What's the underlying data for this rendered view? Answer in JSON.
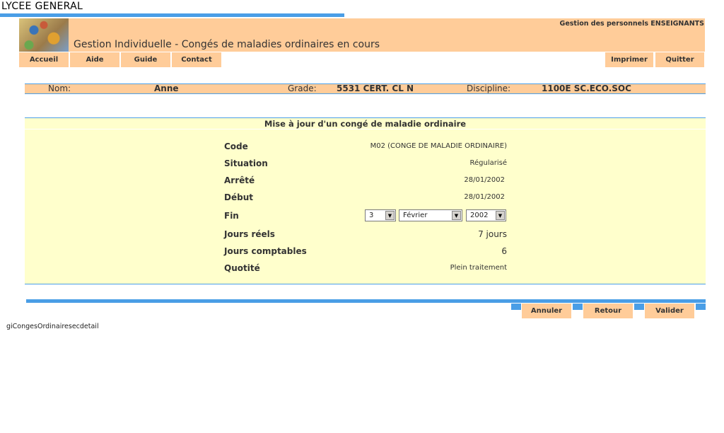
{
  "top": {
    "school": "LYCEE GENERAL"
  },
  "header": {
    "module": "Gestion des personnels ENSEIGNANTS",
    "title": "Gestion Individuelle - Congés de maladies ordinaires en cours"
  },
  "nav": {
    "left": [
      "Accueil",
      "Aide",
      "Guide",
      "Contact"
    ],
    "right": [
      "Imprimer",
      "Quitter"
    ]
  },
  "agent": {
    "nom_label": "Nom:",
    "nom_value": "Anne",
    "grade_label": "Grade:",
    "grade_value": "5531 CERT. CL N",
    "discipline_label": "Discipline:",
    "discipline_value": "1100E SC.ECO.SOC"
  },
  "form": {
    "title": "Mise à jour d'un congé de maladie ordinaire",
    "code_label": "Code",
    "code_value": "M02 (CONGE DE MALADIE ORDINAIRE)",
    "situation_label": "Situation",
    "situation_value": "Régularisé",
    "arrete_label": "Arrêté",
    "arrete_value": "28/01/2002",
    "debut_label": "Début",
    "debut_value": "28/01/2002",
    "fin_label": "Fin",
    "fin_day": "3",
    "fin_month": "Février",
    "fin_year": "2002",
    "jours_reels_label": "Jours réels",
    "jours_reels_value": "7 jours",
    "jours_comptables_label": "Jours comptables",
    "jours_comptables_value": "6",
    "quotite_label": "Quotité",
    "quotite_value": "Plein traitement"
  },
  "actions": {
    "annuler": "Annuler",
    "retour": "Retour",
    "valider": "Valider"
  },
  "footer": {
    "page_id": "giCongesOrdinairesecdetail"
  },
  "colors": {
    "accent_blue": "#4a9ee6",
    "peach": "#ffcc99",
    "panel_yellow": "#ffffcc"
  }
}
